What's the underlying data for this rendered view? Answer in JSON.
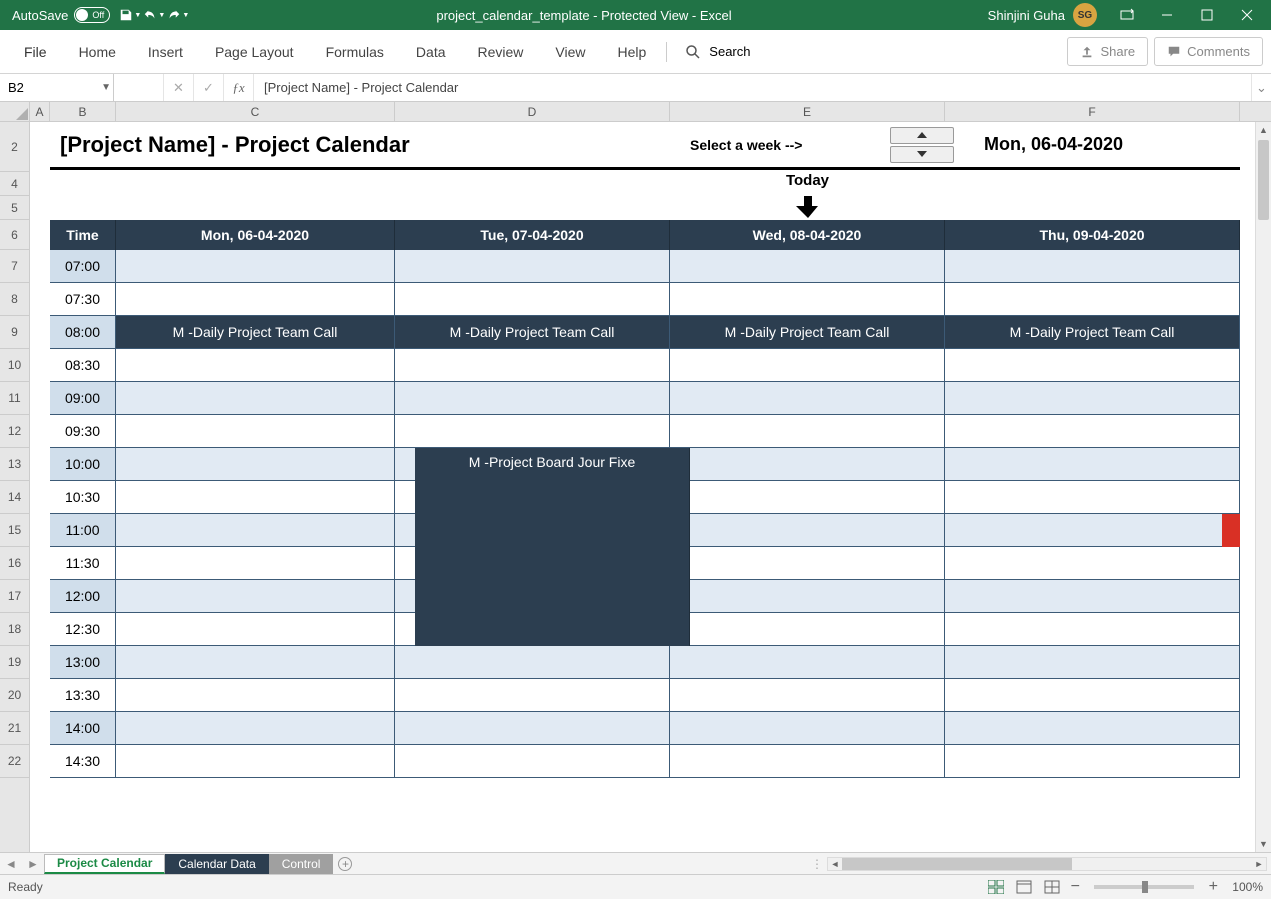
{
  "titlebar": {
    "autosave_label": "AutoSave",
    "autosave_state": "Off",
    "title": "project_calendar_template  -  Protected View  -  Excel",
    "user_name": "Shinjini Guha",
    "user_initials": "SG"
  },
  "ribbon": {
    "tabs": [
      "File",
      "Home",
      "Insert",
      "Page Layout",
      "Formulas",
      "Data",
      "Review",
      "View",
      "Help"
    ],
    "search_placeholder": "Search",
    "share_label": "Share",
    "comments_label": "Comments"
  },
  "formula_bar": {
    "name_box": "B2",
    "formula": "[Project Name] - Project Calendar"
  },
  "columns": [
    "A",
    "B",
    "C",
    "D",
    "E",
    "F"
  ],
  "rows_visible": [
    "2",
    "4",
    "5",
    "6",
    "7",
    "8",
    "9",
    "10",
    "11",
    "12",
    "13",
    "14",
    "15",
    "16",
    "17",
    "18",
    "19",
    "20",
    "21",
    "22"
  ],
  "sheet": {
    "project_title": "[Project Name] - Project Calendar",
    "select_week_label": "Select a week -->",
    "selected_week": "Mon, 06-04-2020",
    "today_label": "Today"
  },
  "calendar": {
    "time_header": "Time",
    "day_headers": [
      "Mon, 06-04-2020",
      "Tue, 07-04-2020",
      "Wed, 08-04-2020",
      "Thu, 09-04-2020"
    ],
    "time_slots": [
      "07:00",
      "07:30",
      "08:00",
      "08:30",
      "09:00",
      "09:30",
      "10:00",
      "10:30",
      "11:00",
      "11:30",
      "12:00",
      "12:30",
      "13:00",
      "13:30",
      "14:00",
      "14:30"
    ],
    "daily_event": "M -Daily Project Team Call",
    "board_event": "M -Project Board Jour Fixe"
  },
  "sheet_tabs": [
    "Project Calendar",
    "Calendar Data",
    "Control"
  ],
  "statusbar": {
    "ready": "Ready",
    "zoom": "100%"
  }
}
